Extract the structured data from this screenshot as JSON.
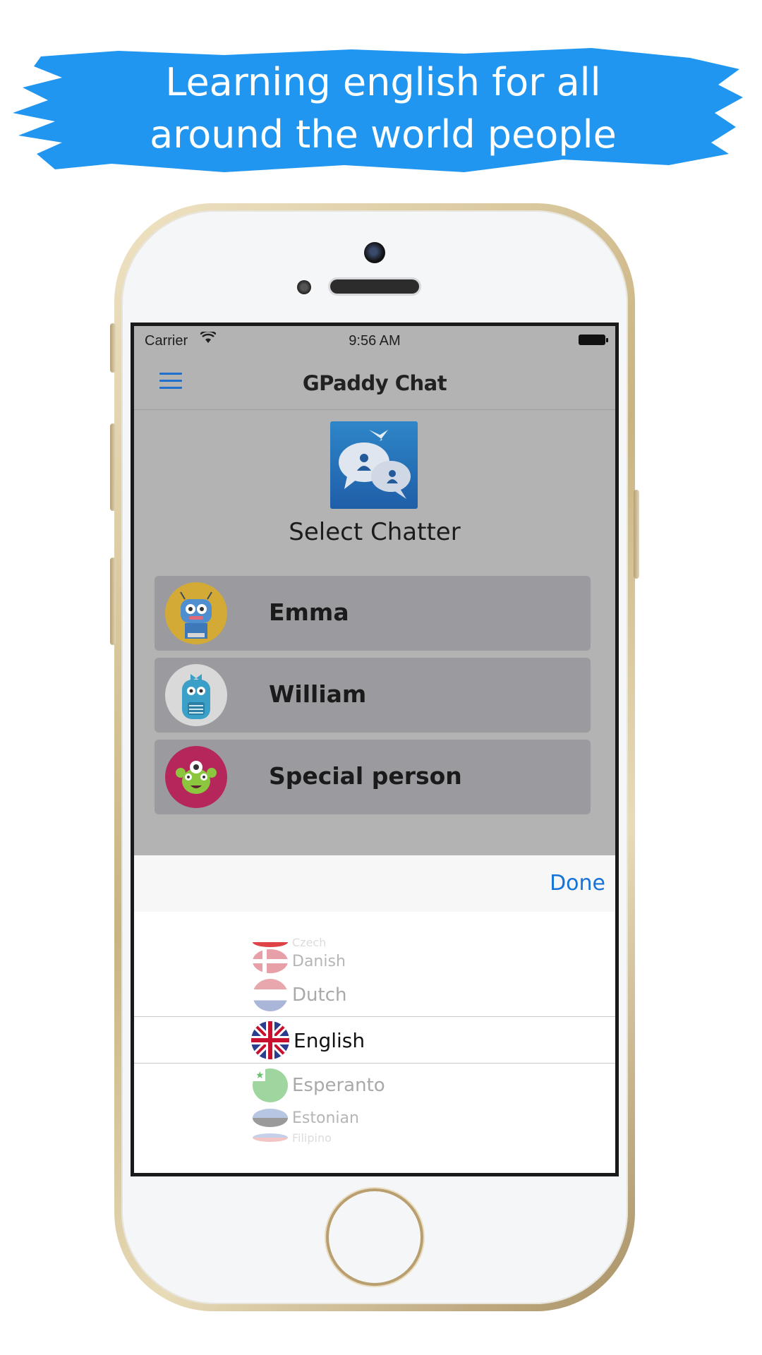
{
  "banner": {
    "line1": "Learning english for all",
    "line2": "around the world people",
    "color": "#2196f0"
  },
  "status_bar": {
    "carrier": "Carrier",
    "time": "9:56 AM"
  },
  "nav": {
    "title": "GPaddy Chat",
    "menu_icon": "hamburger-menu-icon"
  },
  "main": {
    "logo_icon": "chat-bubbles-logo-icon",
    "select_label": "Select Chatter",
    "chatters": [
      {
        "name": "Emma",
        "avatar_color": "#d4aa37"
      },
      {
        "name": "William",
        "avatar_color": "#d9d9d9"
      },
      {
        "name": "Special person",
        "avatar_color": "#b5275b"
      }
    ]
  },
  "picker": {
    "done_label": "Done",
    "selected": "English",
    "options": [
      "Czech",
      "Danish",
      "Dutch",
      "English",
      "Esperanto",
      "Estonian",
      "Filipino"
    ]
  },
  "colors": {
    "accent": "#1673d8",
    "screen_bg": "#b3b3b3",
    "row_bg": "#9b9b9f"
  }
}
